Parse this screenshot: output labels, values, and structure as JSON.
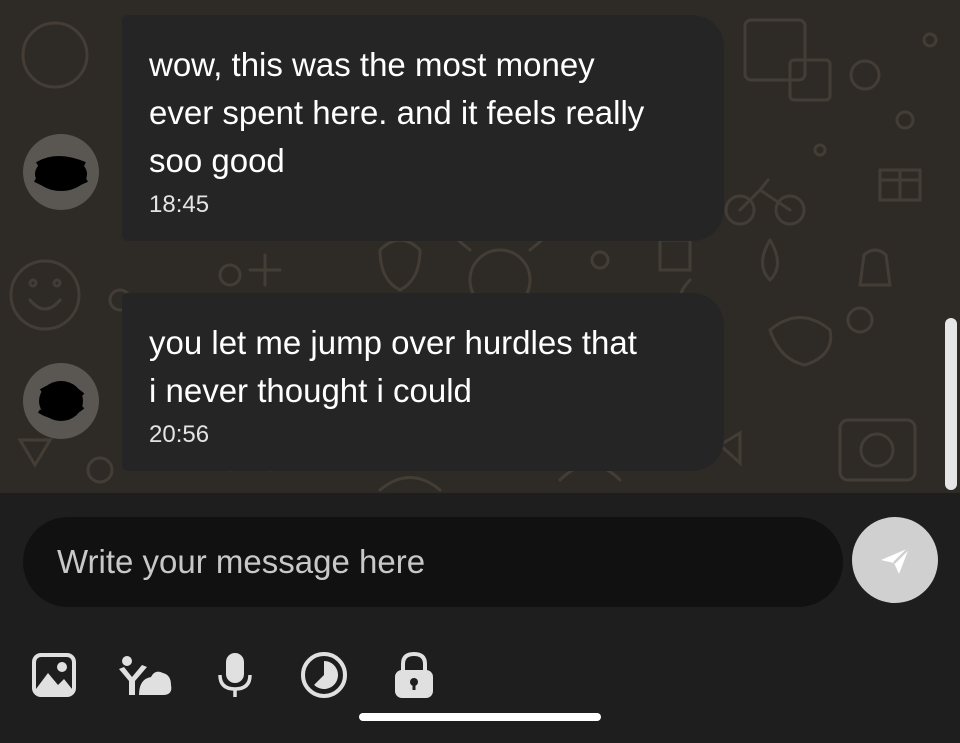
{
  "messages": [
    {
      "text": "wow, this was the most money\never spent here. and it feels really\nsoo good",
      "time": "18:45"
    },
    {
      "text": "you let me jump over hurdles that\ni never thought i could",
      "time": "20:56"
    }
  ],
  "composer": {
    "placeholder": "Write your message here",
    "send_icon": "send-icon"
  },
  "toolbar": {
    "icons": [
      "image-icon",
      "sticker-icon",
      "microphone-icon",
      "timer-icon",
      "lock-icon"
    ]
  },
  "colors": {
    "chat_background": "#2e2b27",
    "bubble": "#252525",
    "composer_background": "#1e1e1e",
    "input_background": "#111111",
    "send_button": "#d0d0d0"
  }
}
